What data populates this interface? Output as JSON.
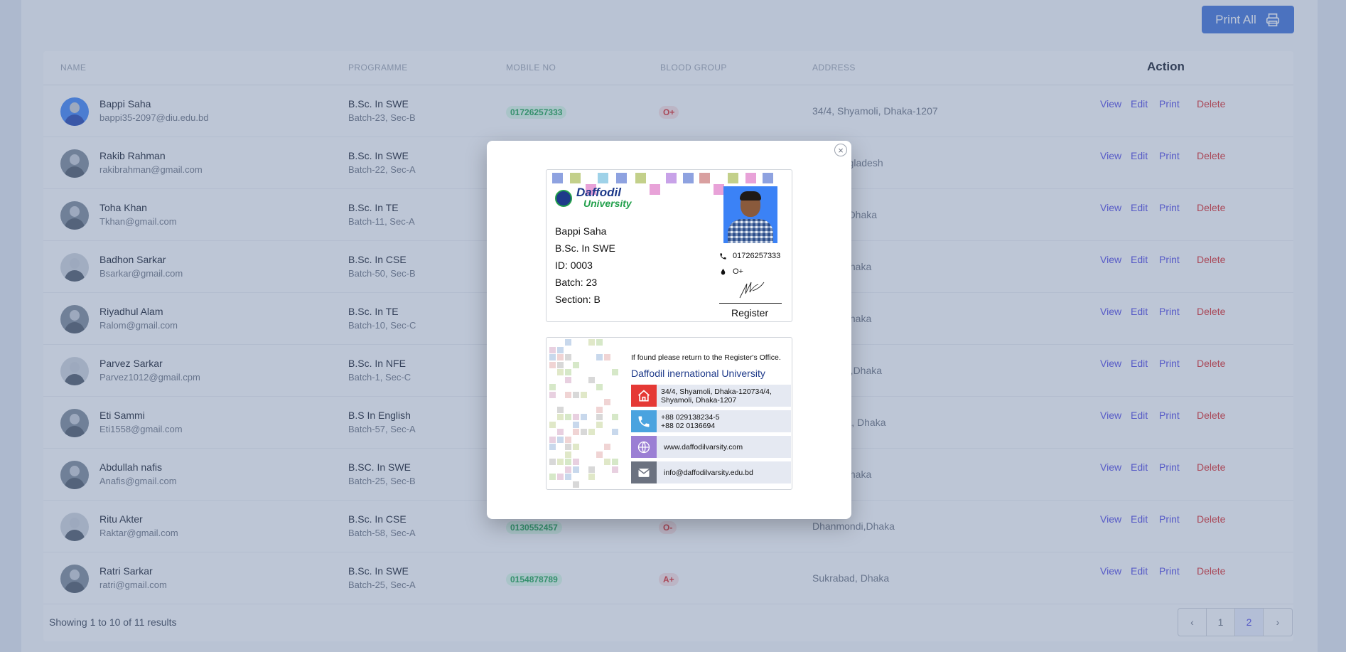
{
  "toolbar": {
    "print_all_label": "Print All"
  },
  "table": {
    "headers": {
      "name": "NAME",
      "programme": "PROGRAMME",
      "mobile": "MOBILE NO",
      "blood": "BLOOD GROUP",
      "address": "ADDRESS",
      "action": "Action"
    },
    "actions": {
      "view": "View",
      "edit": "Edit",
      "print": "Print",
      "delete": "Delete"
    },
    "rows": [
      {
        "name": "Bappi Saha",
        "email": "bappi35-2097@diu.edu.bd",
        "programme": "B.Sc. In SWE",
        "batch": "Batch-23, Sec-B",
        "mobile": "01726257333",
        "blood": "O+",
        "address": "34/4, Shyamoli, Dhaka-1207"
      },
      {
        "name": "Rakib Rahman",
        "email": "rakibrahman@gmail.com",
        "programme": "B.Sc. In SWE",
        "batch": "Batch-22, Sec-A",
        "mobile": "",
        "blood": "",
        "address": "angladesh"
      },
      {
        "name": "Toha Khan",
        "email": "Tkhan@gmail.com",
        "programme": "B.Sc. In TE",
        "batch": "Batch-11, Sec-A",
        "mobile": "",
        "blood": "",
        "address": "ur,Dhaka"
      },
      {
        "name": "Badhon Sarkar",
        "email": "Bsarkar@gmail.com",
        "programme": "B.Sc. In CSE",
        "batch": "Batch-50, Sec-B",
        "mobile": "",
        "blood": "",
        "address": ", Dhaka"
      },
      {
        "name": "Riyadhul Alam",
        "email": "Ralom@gmail.com",
        "programme": "B.Sc. In TE",
        "batch": "Batch-10, Sec-C",
        "mobile": "",
        "blood": "",
        "address": ", Dhaka"
      },
      {
        "name": "Parvez Sarkar",
        "email": "Parvez1012@gmail.cpm",
        "programme": "B.Sc. In NFE",
        "batch": "Batch-1, Sec-C",
        "mobile": "",
        "blood": "",
        "address": "ndi,Dhaka"
      },
      {
        "name": "Eti Sammi",
        "email": "Eti1558@gmail.com",
        "programme": "B.S In English",
        "batch": "Batch-57, Sec-A",
        "mobile": "",
        "blood": "",
        "address": "ara, Dhaka"
      },
      {
        "name": "Abdullah nafis",
        "email": "Anafis@gmail.com",
        "programme": "B.SC. In SWE",
        "batch": "Batch-25, Sec-B",
        "mobile": "",
        "blood": "",
        "address": ", Dhaka"
      },
      {
        "name": "Ritu Akter",
        "email": "Raktar@gmail.com",
        "programme": "B.Sc. In CSE",
        "batch": "Batch-58, Sec-A",
        "mobile": "0130552457",
        "blood": "O-",
        "address": "Dhanmondi,Dhaka"
      },
      {
        "name": "Ratri Sarkar",
        "email": "ratri@gmail.com",
        "programme": "B.Sc. In SWE",
        "batch": "Batch-25, Sec-A",
        "mobile": "0154878789",
        "blood": "A+",
        "address": "Sukrabad, Dhaka"
      }
    ],
    "showing": "Showing 1 to 10 of 11 results",
    "pagination": {
      "prev": "‹",
      "pages": [
        "1",
        "2"
      ],
      "next": "›",
      "current": "2"
    }
  },
  "modal": {
    "close_label": "×",
    "front": {
      "logo_line1": "Daffodil",
      "logo_line2": "University",
      "name": "Bappi Saha",
      "programme": "B.Sc. In SWE",
      "id": "ID: 0003",
      "batch": "Batch: 23",
      "section": "Section: B",
      "phone": "01726257333",
      "blood": "O+",
      "signature_label": "Register"
    },
    "back": {
      "found_text": "If found please return to the Register's Office.",
      "university": "Daffodil inernational University",
      "address_line1": "34/4, Shyamoli, Dhaka-120734/4,",
      "address_line2": "Shyamoli, Dhaka-1207",
      "phone1": "+88 029138234-5",
      "phone2": "+88 02 0136694",
      "website": "www.daffodilvarsity.com",
      "email": "info@daffodilvarsity.edu.bd"
    }
  },
  "colors": {
    "primary": "#3b6fd8",
    "home_icon": "#e53935",
    "phone_icon": "#4aa3df",
    "web_icon": "#9b7fd4",
    "mail_icon": "#6b7280"
  }
}
